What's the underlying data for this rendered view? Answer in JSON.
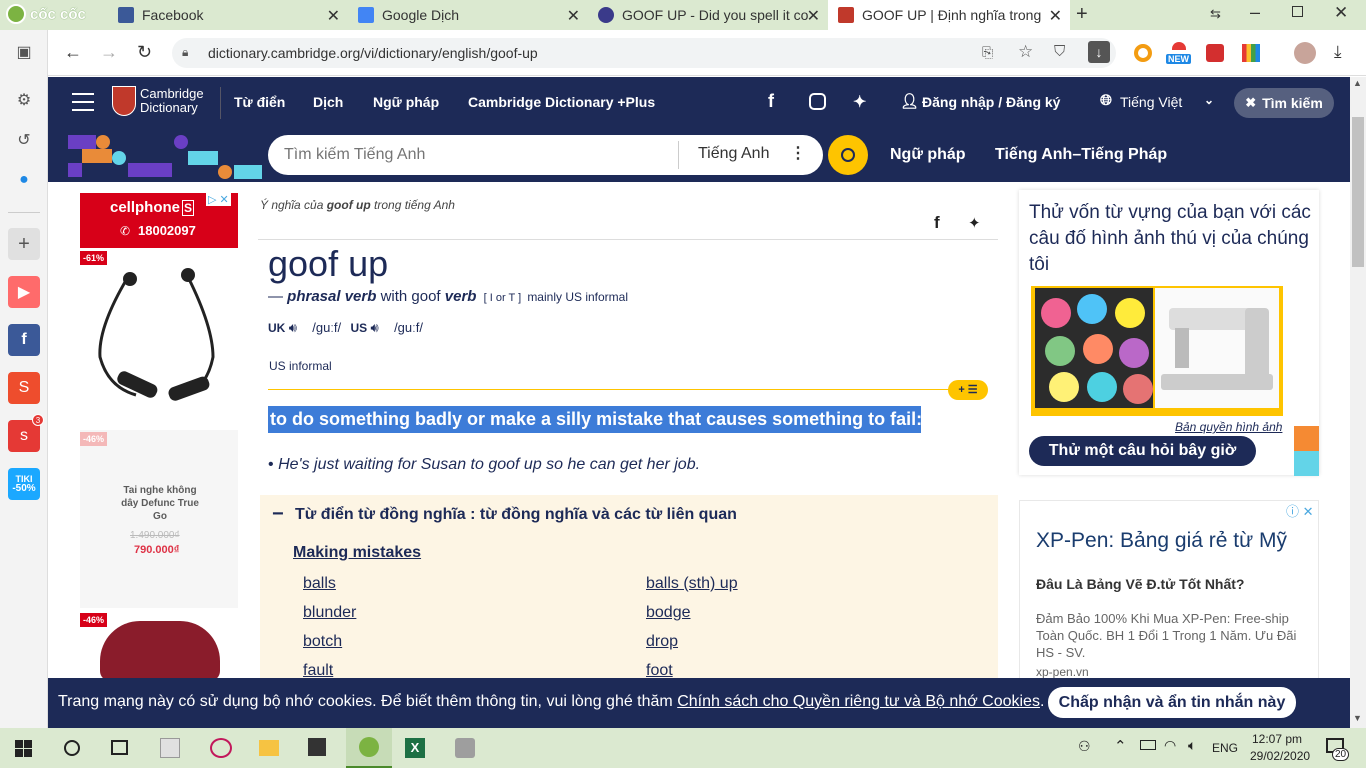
{
  "browser": {
    "brand": "cốc cốc",
    "tabs": [
      {
        "label": "Facebook"
      },
      {
        "label": "Google Dịch"
      },
      {
        "label": "GOOF UP - Did you spell it co"
      },
      {
        "label": "GOOF UP | Định nghĩa trong T"
      }
    ],
    "url": "dictionary.cambridge.org/vi/dictionary/english/goof-up",
    "ext_badge": "NEW"
  },
  "sidebar": {
    "shopee_badge": "3",
    "tiki_label": "TIKI",
    "tiki_pct": "-50%"
  },
  "nav": {
    "logo_line1": "Cambridge",
    "logo_line2": "Dictionary",
    "items": [
      "Từ điển",
      "Dịch",
      "Ngữ pháp",
      "Cambridge Dictionary +Plus"
    ],
    "login": "Đăng nhập / Đăng ký",
    "language": "Tiếng Việt",
    "search_btn": "Tìm kiếm"
  },
  "search": {
    "placeholder": "Tìm kiếm Tiếng Anh",
    "lang": "Tiếng Anh",
    "link1": "Ngữ pháp",
    "link2": "Tiếng Anh–Tiếng Pháp"
  },
  "ad_left": {
    "brand": "cellphone",
    "brand_s": "S",
    "phone": "18002097",
    "d1": "-61%",
    "d2": "-46%",
    "d3": "-46%",
    "product_name": "Tai nghe không dây Defunc True Go",
    "old_price": "1.490.000₫",
    "new_price": "790.000₫"
  },
  "entry": {
    "breadcrumb_pre": "Ý nghĩa của ",
    "breadcrumb_word": "goof up",
    "breadcrumb_post": " trong tiếng Anh",
    "headword": "goof up",
    "pos_dash": "—",
    "pos": "phrasal verb",
    "with": "with goof",
    "verb": "verb",
    "gram": "[ I or T ]",
    "labels": "mainly US informal",
    "uk": "UK",
    "uk_ipa": "/ɡuːf/",
    "us": "US",
    "us_ipa": "/ɡuːf/",
    "us_informal": "US informal",
    "definition": "to do something badly or make a silly mistake that causes something to fail:",
    "example": "He's just waiting for Susan to goof up so he can get her job."
  },
  "thesaurus": {
    "title": "Từ điển từ đồng nghĩa : từ đồng nghĩa và các từ liên quan",
    "subtitle": "Making mistakes",
    "left": [
      "balls",
      "blunder",
      "botch",
      "fault"
    ],
    "right": [
      "balls (sth) up",
      "bodge",
      "drop",
      "foot"
    ]
  },
  "right_quiz": {
    "text": "Thử vốn từ vựng của bạn với các câu đố hình ảnh thú vị của chúng tôi",
    "credit": "Bản quyền hình ảnh",
    "button": "Thử một câu hỏi bây giờ"
  },
  "right_ad": {
    "title": "XP-Pen: Bảng giá rẻ từ Mỹ",
    "sub": "Đâu Là Bảng Vẽ Đ.tử Tốt Nhất?",
    "body": "Đảm Bảo 100% Khi Mua XP-Pen: Free-ship Toàn Quốc. BH 1 Đổi 1 Trong 1 Năm. Ưu Đãi HS - SV.",
    "url": "xp-pen.vn"
  },
  "cookie": {
    "text": "Trang mạng này có sử dụng bộ nhớ cookies. Để biết thêm thông tin, vui lòng ghé thăm",
    "link": "Chính sách cho Quyền riêng tư và Bộ nhớ Cookies",
    "period": ".",
    "button": "Chấp nhận và ẩn tin nhắn này"
  },
  "taskbar": {
    "lang": "ENG",
    "time": "12:07 pm",
    "date": "29/02/2020",
    "notif": "20"
  }
}
